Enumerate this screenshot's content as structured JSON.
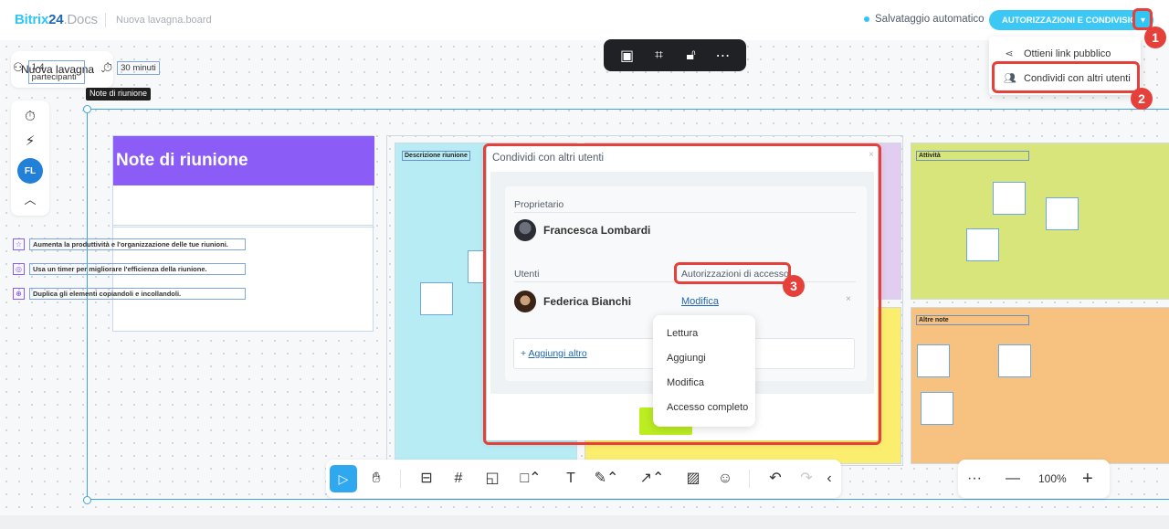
{
  "header": {
    "logo_part1": "Bitrix",
    "logo_part2": "24",
    "logo_part3": ".Docs",
    "document_name": "Nuova lavagna.board",
    "autosave_label": "Salvataggio automatico",
    "permissions_button": "AUTORIZZAZIONI E CONDIVISIONE"
  },
  "share_menu": {
    "items": [
      {
        "label": "Ottieni link pubblico",
        "icon": "share-icon"
      },
      {
        "label": "Condividi con altri utenti",
        "icon": "add-user-icon"
      }
    ]
  },
  "board": {
    "menu_label": "Nuova lavagna",
    "tooltip": "Note di riunione",
    "user_initials": "FL"
  },
  "note_card": {
    "title": "Note di riunione",
    "participants": "1-4 partecipanti",
    "duration": "30 minuti",
    "tips": [
      "Aumenta la produttività e l'organizzazione delle tue riunioni.",
      "Usa un timer per migliorare l'efficienza della riunione.",
      "Duplica gli elementi copiandoli e incollandoli."
    ]
  },
  "sections": {
    "description": "Descrizione riunione",
    "activities": "Attività",
    "other_notes": "Altre note"
  },
  "share_dialog": {
    "title": "Condividi con altri utenti",
    "owner_label": "Proprietario",
    "owner_name": "Francesca Lombardi",
    "users_label": "Utenti",
    "access_label": "Autorizzazioni di accesso",
    "user_name": "Federica Bianchi",
    "user_access": "Modifica",
    "add_more": "Aggiungi altro",
    "close": "×",
    "remove": "×"
  },
  "permission_options": [
    "Lettura",
    "Aggiungi",
    "Modifica",
    "Accesso completo"
  ],
  "annotations": {
    "badge1": "1",
    "badge2": "2",
    "badge3": "3",
    "highlight_color": "#e5403a"
  },
  "zoom": {
    "level": "100%",
    "more": "···",
    "minus": "—",
    "plus": "+"
  },
  "colors": {
    "accent": "#3bc8f5",
    "note_header": "#8b5cf6",
    "description_bg": "#b7ecf5",
    "activities_bg": "#d7e57a",
    "other_notes_bg": "#f7c27f",
    "purple_section": "#e0cdf0",
    "yellow_section": "#fbee6e"
  }
}
